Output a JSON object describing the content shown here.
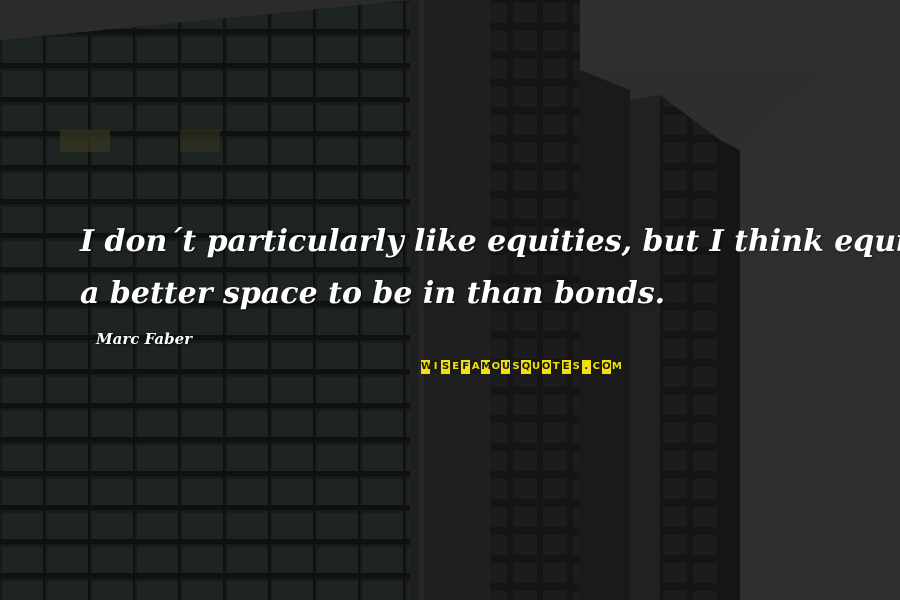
{
  "quote": {
    "line1": "I don´t particularly like equities, but I think equities are",
    "line2": "a better space to be in than bonds."
  },
  "author": "Marc Faber",
  "logo": {
    "text": "WISEFAMOUSQUOTES.COM",
    "colors": {
      "yellow": "#f0e010",
      "dark": "#1a1a1a"
    }
  }
}
